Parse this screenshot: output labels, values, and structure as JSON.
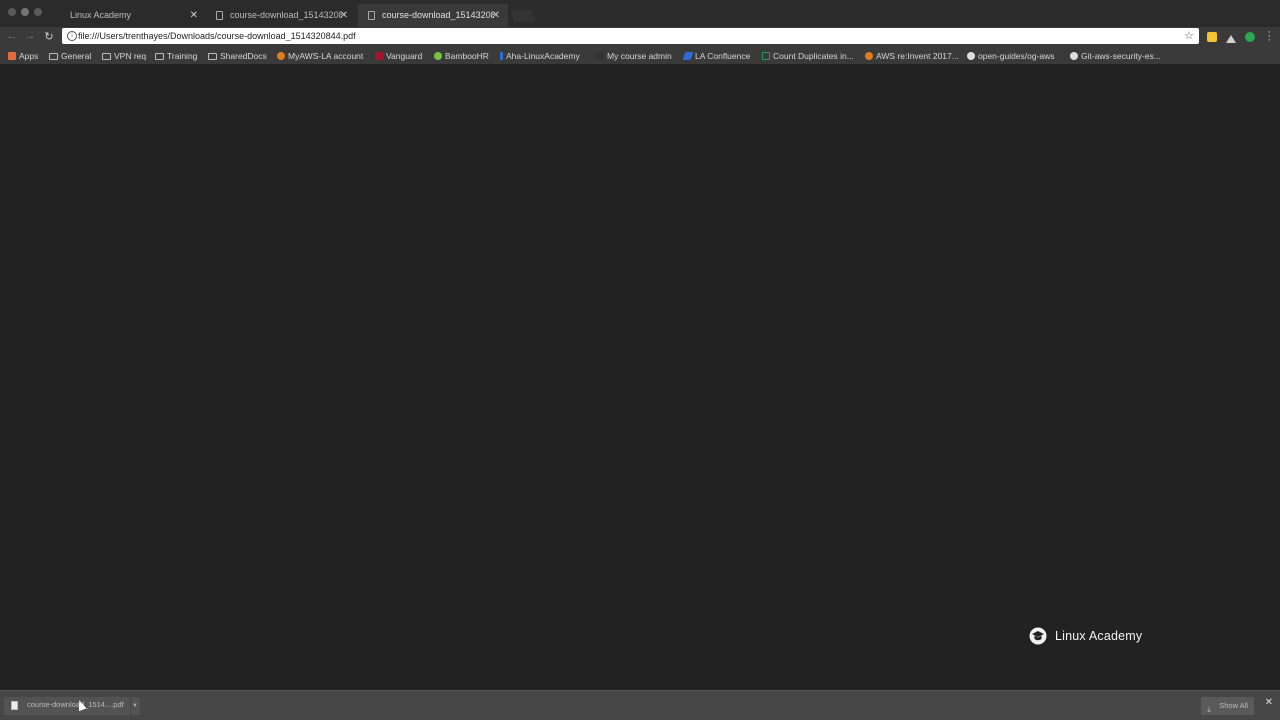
{
  "tabs": [
    {
      "label": "Linux Academy",
      "active": false
    },
    {
      "label": "course-download_151432084",
      "active": false
    },
    {
      "label": "course-download_151432084",
      "active": true
    }
  ],
  "toolbar": {
    "url": "file:///Users/trenthayes/Downloads/course-download_1514320844.pdf"
  },
  "bookmarks": [
    {
      "label": "Apps",
      "icon": "apps-grid-icon",
      "color": "#e46c3c"
    },
    {
      "label": "General",
      "icon": "folder-icon"
    },
    {
      "label": "VPN req",
      "icon": "folder-icon"
    },
    {
      "label": "Training",
      "icon": "folder-icon"
    },
    {
      "label": "SharedDocs",
      "icon": "folder-icon"
    },
    {
      "label": "MyAWS-LA account",
      "icon": "aws-icon",
      "color": "#e07b24"
    },
    {
      "label": "Vanguard",
      "icon": "vanguard-icon",
      "color": "#a0162c"
    },
    {
      "label": "BambooHR",
      "icon": "bamboohr-icon",
      "color": "#7ac142"
    },
    {
      "label": "Aha-LinuxAcademy",
      "icon": "aha-icon",
      "color": "#2f6fd6"
    },
    {
      "label": "My course admin",
      "icon": "linux-academy-icon",
      "color": "#333333"
    },
    {
      "label": "LA Confluence",
      "icon": "confluence-icon",
      "color": "#2e6bd9"
    },
    {
      "label": "Count Duplicates in...",
      "icon": "sheet-icon",
      "color": "#1f9d55"
    },
    {
      "label": "AWS re:Invent 2017...",
      "icon": "aws-icon",
      "color": "#e07b24"
    },
    {
      "label": "open-guides/og-aws",
      "icon": "github-icon",
      "color": "#dddddd"
    },
    {
      "label": "Git-aws-security-es...",
      "icon": "github-icon",
      "color": "#dddddd"
    }
  ],
  "content": {
    "logo_text": "Linux Academy"
  },
  "downloads": {
    "item_name": "course-download_1514....pdf",
    "show_all": "Show All"
  },
  "colors": {
    "content_bg": "#222222",
    "chrome_bg": "#3a3a3a",
    "shelf_bg": "#474747"
  }
}
